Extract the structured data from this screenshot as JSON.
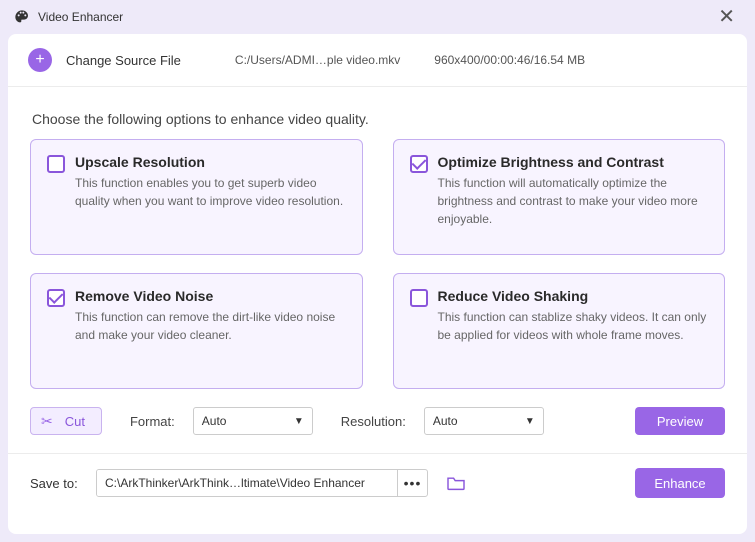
{
  "window": {
    "title": "Video Enhancer"
  },
  "source": {
    "change_label": "Change Source File",
    "path": "C:/Users/ADMI…ple video.mkv",
    "meta": "960x400/00:00:46/16.54 MB"
  },
  "instruction": "Choose the following options to enhance video quality.",
  "options": [
    {
      "title": "Upscale Resolution",
      "desc": "This function enables you to get superb video quality when you want to improve video resolution.",
      "checked": false
    },
    {
      "title": "Optimize Brightness and Contrast",
      "desc": "This function will automatically optimize the brightness and contrast to make your video more enjoyable.",
      "checked": true
    },
    {
      "title": "Remove Video Noise",
      "desc": "This function can remove the dirt-like video noise and make your video cleaner.",
      "checked": true
    },
    {
      "title": "Reduce Video Shaking",
      "desc": "This function can stablize shaky videos. It can only be applied for videos with whole frame moves.",
      "checked": false
    }
  ],
  "cut_label": "Cut",
  "format": {
    "label": "Format:",
    "value": "Auto"
  },
  "resolution": {
    "label": "Resolution:",
    "value": "Auto"
  },
  "preview_label": "Preview",
  "save": {
    "label": "Save to:",
    "path": "C:\\ArkThinker\\ArkThink…ltimate\\Video Enhancer"
  },
  "enhance_label": "Enhance"
}
